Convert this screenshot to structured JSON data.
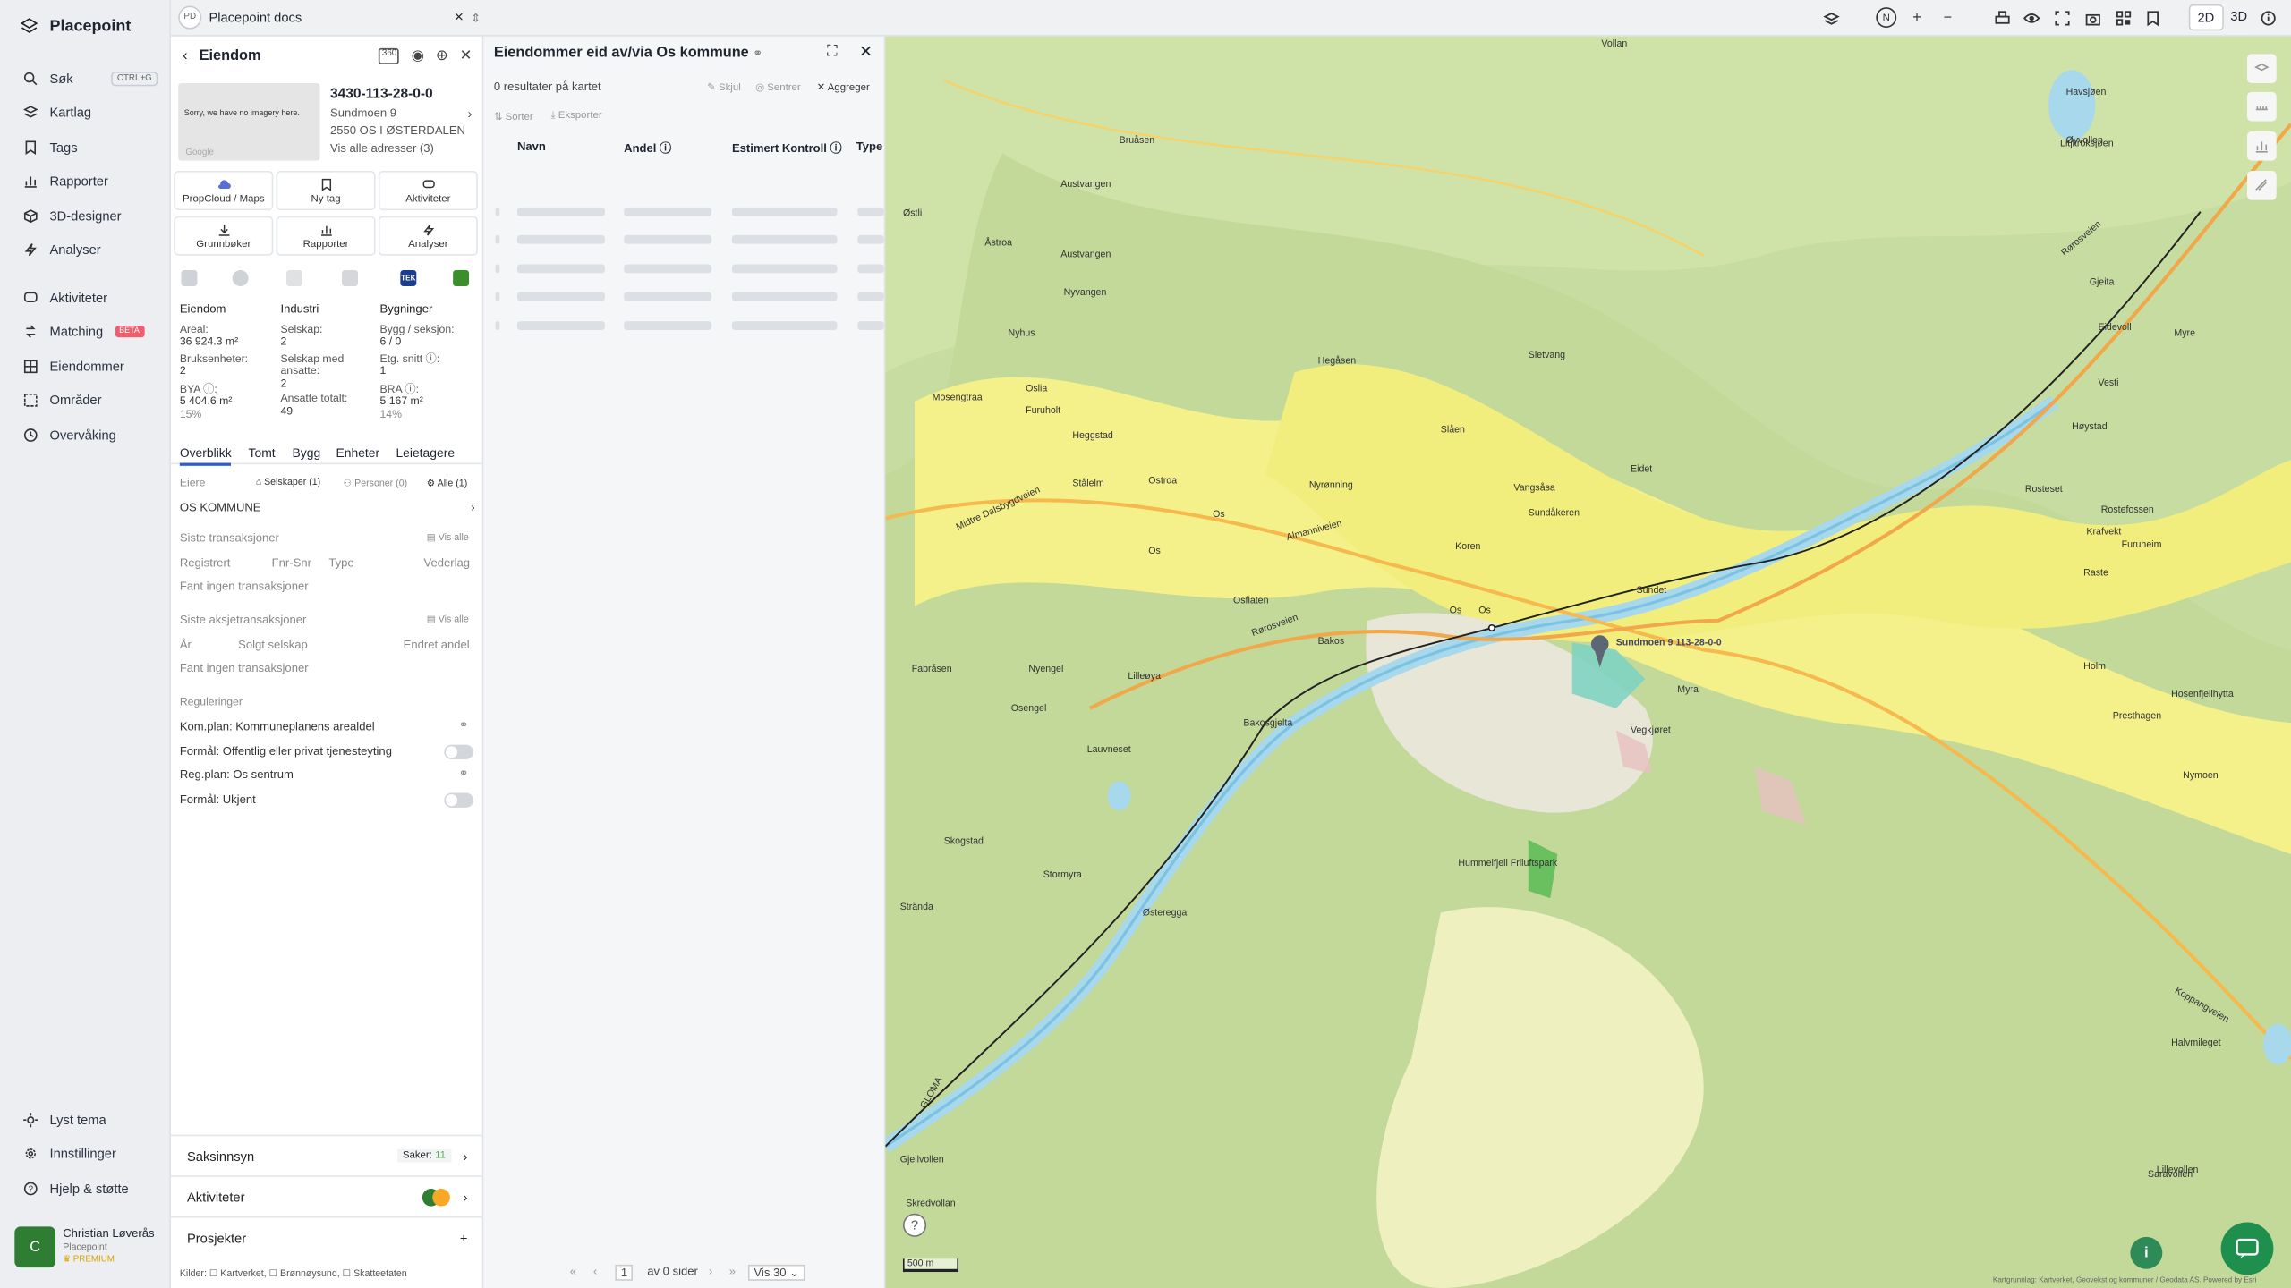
{
  "brand": "Placepoint",
  "nav": {
    "items": [
      {
        "label": "Søk",
        "kbd": "CTRL+G"
      },
      {
        "label": "Kartlag"
      },
      {
        "label": "Tags"
      },
      {
        "label": "Rapporter"
      },
      {
        "label": "3D-designer"
      },
      {
        "label": "Analyser"
      },
      {
        "label": "Aktiviteter"
      },
      {
        "label": "Matching",
        "badge": "BETA"
      },
      {
        "label": "Eiendommer"
      },
      {
        "label": "Områder"
      },
      {
        "label": "Overvåking"
      }
    ],
    "bottom": [
      {
        "label": "Lyst tema"
      },
      {
        "label": "Innstillinger"
      },
      {
        "label": "Hjelp & støtte"
      }
    ],
    "user": {
      "initial": "C",
      "name": "Christian Løverås",
      "org": "Placepoint",
      "plan": "PREMIUM"
    }
  },
  "top": {
    "badge": "PD",
    "search_value": "Placepoint docs",
    "dim2d": "2D",
    "dim3d": "3D"
  },
  "property": {
    "title": "Eiendom",
    "icon360": "360",
    "thumb_text": "Sorry, we have no imagery here.",
    "thumb_logo": "Google",
    "id": "3430-113-28-0-0",
    "address": "Sundmoen 9",
    "postal": "2550 OS I ØSTERDALEN",
    "all_addresses": "Vis alle adresser (3)",
    "actions": [
      "PropCloud / Maps",
      "Ny tag",
      "Aktiviteter",
      "Grunnbøker",
      "Rapporter",
      "Analyser"
    ],
    "tek_label": "TEK",
    "stats": {
      "c1_head": "Eiendom",
      "area_k": "Areal:",
      "area_v": "36 924.3 m²",
      "units_k": "Bruksenheter:",
      "units_v": "2",
      "bya_k": "BYA ⓘ:",
      "bya_v": "5 404.6 m²",
      "bya_p": "15%",
      "c2_head": "Industri",
      "sel_k": "Selskap:",
      "sel_v": "2",
      "selemp_k": "Selskap med ansatte:",
      "selemp_v": "2",
      "emp_k": "Ansatte totalt:",
      "emp_v": "49",
      "c3_head": "Bygninger",
      "bygg_k": "Bygg / seksjon:",
      "bygg_v": "6 / 0",
      "etg_k": "Etg. snitt ⓘ:",
      "etg_v": "1",
      "bra_k": "BRA ⓘ:",
      "bra_v": "5 167 m²",
      "bra_p": "14%"
    },
    "tabs": [
      "Overblikk",
      "Tomt",
      "Bygg",
      "Enheter",
      "Leietagere"
    ],
    "owners": {
      "label": "Eiere",
      "f1": "Selskaper (1)",
      "f2": "Personer (0)",
      "f3": "Alle (1)",
      "owner": "OS KOMMUNE"
    },
    "tx": {
      "title": "Siste transaksjoner",
      "showall": "Vis alle",
      "c1": "Registrert",
      "c2": "Fnr-Snr",
      "c3": "Type",
      "c4": "Vederlag",
      "empty": "Fant ingen transaksjoner"
    },
    "stx": {
      "title": "Siste aksjetransaksjoner",
      "showall": "Vis alle",
      "c1": "År",
      "c2": "Solgt selskap",
      "c3": "Endret andel",
      "empty": "Fant ingen transaksjoner"
    },
    "reg": {
      "title": "Reguleringer",
      "r1": "Kom.plan: Kommuneplanens arealdel",
      "r2": "Formål: Offentlig eller privat tjenesteyting",
      "r3": "Reg.plan: Os sentrum",
      "r4": "Formål: Ukjent"
    },
    "saksinnsyn": {
      "label": "Saksinnsyn",
      "cases_label": "Saker:",
      "cases_value": "11"
    },
    "aktiviteter": "Aktiviteter",
    "prosjekter": "Prosjekter",
    "sources": "Kilder: ☐ Kartverket, ☐ Brønnøysund, ☐ Skatteetaten"
  },
  "results": {
    "title": "Eiendommer eid av/via Os kommune",
    "count": "0 resultater på kartet",
    "skjul": "Skjul",
    "sentrer": "Sentrer",
    "aggreger": "Aggreger",
    "sorter": "Sorter",
    "eksporter": "Eksporter",
    "cols": [
      "Navn",
      "Andel ⓘ",
      "Estimert Kontroll ⓘ",
      "Type"
    ],
    "page": "1",
    "of_pages": "av 0 sider",
    "per_page": "Vis 30"
  },
  "map": {
    "labels": [
      "Vollan",
      "Havsjøen",
      "Litjkroksjøen",
      "Bruåsen",
      "Øyvollen",
      "Austvangen",
      "Østli",
      "Åstroa",
      "Austvangen",
      "Nyvangen",
      "Gjeita",
      "Eidevoll",
      "Nyhus",
      "Sletvang",
      "Hegåsen",
      "Myre",
      "Vesti",
      "Oslia",
      "Furuholt",
      "Mosengtraa",
      "Heggstad",
      "Slåen",
      "Høystad",
      "Stålelm",
      "Ostroa",
      "Nyrønning",
      "Vangsåsa",
      "Eidet",
      "Rosteset",
      "Rostefossen",
      "Krafvekt",
      "Os",
      "Os",
      "Os",
      "Sundåkeren",
      "Koren",
      "Furuheim",
      "Os",
      "Osflaten",
      "Bakos",
      "Sundet",
      "Raste",
      "Myra",
      "Holm",
      "Fabråsen",
      "Nyengel",
      "Lilleøya",
      "Osengel",
      "Bakosgjelta",
      "Vegkjøret",
      "Presthagen",
      "Hosenfjellhytta",
      "Lauvneset",
      "Nymoen",
      "Skogstad",
      "Stormyra",
      "Hummelfjell Friluftspark",
      "Strända",
      "Østeregga",
      "Halvmileget",
      "Saravollen",
      "Gjellvollen",
      "Skredvollan",
      "Lillevollen",
      "Sundmoen 9 113-28-0-0",
      "Rørosveien",
      "Rørosveien",
      "Almanniveien",
      "Midtre Dalsbygdveien",
      "Koppangveien",
      "GLOMA",
      "500 m",
      "Kartgrunnlag: Kartverket, Geovekst og kommuner / Geodata AS. Powered by Esri"
    ]
  }
}
